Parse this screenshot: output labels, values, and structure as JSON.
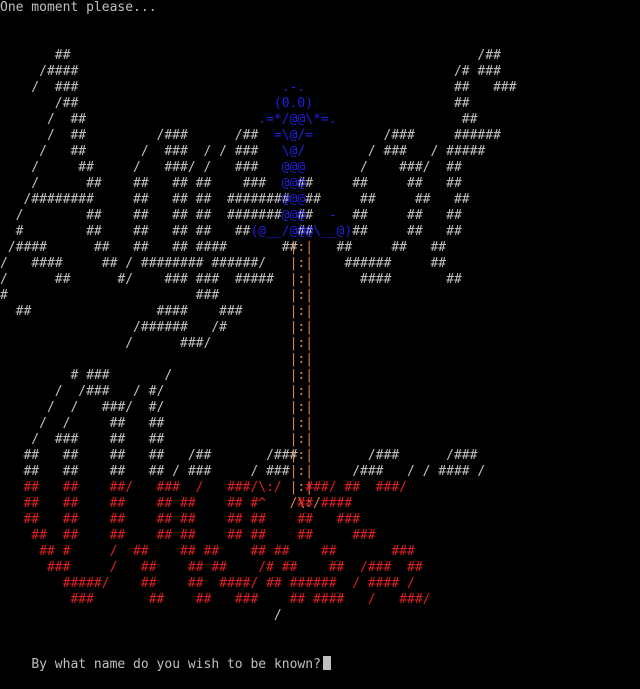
{
  "terminal": {
    "status_message": "One moment please...",
    "prompt": "By what name do you wish to be known?"
  },
  "colors": {
    "background": "#000000",
    "text": "#c0c0c0",
    "wizard": "#2020e0",
    "staff": "#e08040",
    "lower_logo": "#e02020"
  },
  "ascii_art": {
    "grey": [
      "       ##                                                    /##",
      "     /####                                                /# ###",
      "    /  ###                                                ##   ###",
      "       /##                                                ##",
      "      /  ##                                                ##",
      "      /  ##         /###      /##                /###     ######",
      "     /   ##       /  ###  / / ###              / ###   / #####",
      "    /     ##     /   ###/ /   ###             /    ###/  ##",
      "    /      ##    ##   ## ##    ###    ##     ##     ##   ##",
      "   /########     ##   ## ##  ########  ##     ##     ##   ##",
      "  /        ##    ##   ## ##  #######  ##     ##     ##   ##",
      "  #        ##    ##   ## ##   ##      ##     ##     ##   ##",
      " /####      ##   ##   ## ####       ##     ##     ##   ##",
      "/   ####     ## / ######## ######/          ######     ##",
      "/      ##      #/    ### ###  #####           ####       ##",
      "#                        ###",
      "  ##                ####    ###",
      "                 /######   /#",
      "                /      ###/",
      "",
      "         # ###       /",
      "       /  /###   / #/",
      "      /  /   ###/  #/",
      "     /  /     ##   ##",
      "    /  ###    ##   ##",
      "   ##   ##    ##   ##   /##       /###         /###      /###",
      "   ##   ##    ##   ## / ###     / ###        /###   / / #### /",
      "",
      "",
      "",
      "",
      "",
      "",
      "",
      "",
      "                                   /"
    ],
    "blue": [
      "",
      "",
      "                                    .-.",
      "                                   (0.0)",
      "                                 .=*/@@\\*=.",
      "                                   =\\@/=",
      "                                    \\@/",
      "                                    @@@",
      "                                    @@@",
      "                                    @@@",
      "                                    @@@   -",
      "                                (@__/@@@\\__@)"
    ],
    "orange": [
      "",
      "",
      "",
      "",
      "",
      "",
      "",
      "",
      "",
      "",
      "",
      "",
      "                                     |:|",
      "                                     |:|",
      "                                     |:|",
      "                                     |:|",
      "                                     |:|",
      "                                     |:|",
      "                                     |:|",
      "                                     |:|",
      "                                     |:|",
      "                                     |:|",
      "                                     |:|",
      "                                     |:|",
      "                                     |:|",
      "                                     |:|",
      "                                     |:|",
      "                                     |:|",
      "                                     /\\:/"
    ],
    "red": [
      "",
      "",
      "",
      "",
      "",
      "",
      "",
      "",
      "",
      "",
      "",
      "",
      "",
      "",
      "",
      "",
      "",
      "",
      "",
      "",
      "",
      "",
      "",
      "",
      "",
      "",
      "",
      "   ##   ##    ##/   ###  /   ###/\\:/   ###/ ##  ###/",
      "   ##   ##    ##    ## ##    ## #^    ## ####",
      "   ##   ##    ##    ## ##    ## ##    ##   ###",
      "    ##  ##    ##    ## ##    ## ##    ##     ###",
      "     ## #     /  ##    ## ##    ## ##    ##       ###",
      "      ###     /   ##    ## ##    /# ##    ##  /###  ##",
      "        #####/    ##    ##  ####/ ## ######  / #### /",
      "         ###       ##    ##   ###    ## ####   /   ###/"
    ]
  }
}
